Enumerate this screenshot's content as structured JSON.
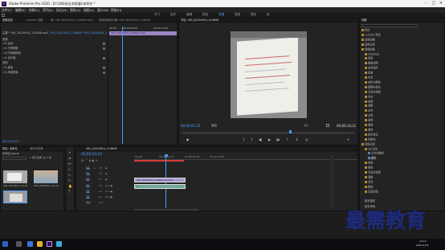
{
  "title_bar": {
    "app_title": "Adobe Premiere Pro 2020 - D:\\\\360安全浏览器\\\\未命名 *",
    "logo": "Pr"
  },
  "menu": [
    "文件(F)",
    "编辑(E)",
    "剪辑(C)",
    "序列(S)",
    "标记(M)",
    "图形(G)",
    "视图(V)",
    "窗口(W)",
    "帮助(H)"
  ],
  "workspaces": [
    "学习",
    "组件",
    "编辑",
    "颜色",
    "效果",
    "音频",
    "图形",
    "库"
  ],
  "active_workspace": "效果",
  "effect_controls": {
    "tabs": [
      "效果控件",
      "Lumetri 范围",
      "源: VID_20210924_114658.mp4",
      "音频剪辑混合器: VID_20210924_114658"
    ],
    "clip_label": "主要 * VID_20210924_114658.mp4",
    "sequence_label": "VID_20210924_114658 * VID_20210924_114658.mp4",
    "section_video": "视频",
    "rows": [
      "运动",
      "不透明度",
      "时间重映射",
      "百叶窗"
    ],
    "section_audio": "音频",
    "audio_rows": [
      "音量",
      "声道音量"
    ],
    "mini_times": [
      "00;00",
      "00;00;05;00",
      "00;00;10;00"
    ],
    "mini_clip": "VID_20210924_114658.mp4",
    "timecode": "00;00;01;02"
  },
  "program_monitor": {
    "title": "节目: VID_20210924_114658",
    "timecode_left": "00;00;01;02",
    "fit": "适合",
    "quality": "1/2",
    "timecode_right": "00;00;14;21"
  },
  "project": {
    "tabs": [
      "项目: 未命名",
      "媒体浏览器"
    ],
    "file_name": "未命名.prproj",
    "items_count": "1 项已选择, 共 2 项",
    "item1_name": "VID_2021092...",
    "item1_dur": "14;21",
    "item2_name": "VID_2021092...",
    "item2_dur": "14;21"
  },
  "timeline": {
    "tab": "VID_20210924_114658",
    "timecode": "00;00;01;02",
    "ruler": [
      "00;00",
      "00;00;04;29",
      "00;00;09;29",
      "00;00;14;29"
    ],
    "video_tracks": [
      "V3",
      "V2",
      "V1"
    ],
    "audio_tracks": [
      "A1",
      "A2",
      "A3"
    ],
    "mix_label": "混合",
    "mix_value": "0.0",
    "video_clip": "VID_20210924_114658.mp4 [V]",
    "audio_clip": "fx"
  },
  "effects": {
    "title": "效果",
    "items": [
      {
        "label": "预设",
        "indent": 0,
        "type": "folder"
      },
      {
        "label": "Lumetri 预设",
        "indent": 0,
        "type": "folder"
      },
      {
        "label": "音频效果",
        "indent": 0,
        "type": "folder"
      },
      {
        "label": "音频过渡",
        "indent": 0,
        "type": "folder"
      },
      {
        "label": "视频效果",
        "indent": 0,
        "type": "folder"
      },
      {
        "label": "Obsolete",
        "indent": 1,
        "type": "folder"
      },
      {
        "label": "变换",
        "indent": 1,
        "type": "folder"
      },
      {
        "label": "图像控制",
        "indent": 1,
        "type": "folder"
      },
      {
        "label": "实用程序",
        "indent": 1,
        "type": "folder"
      },
      {
        "label": "扭曲",
        "indent": 1,
        "type": "folder"
      },
      {
        "label": "时间",
        "indent": 1,
        "type": "folder"
      },
      {
        "label": "杂色与颗粒",
        "indent": 1,
        "type": "folder"
      },
      {
        "label": "模糊与锐化",
        "indent": 1,
        "type": "folder"
      },
      {
        "label": "沉浸式视频",
        "indent": 1,
        "type": "folder"
      },
      {
        "label": "生成",
        "indent": 1,
        "type": "folder"
      },
      {
        "label": "视频",
        "indent": 1,
        "type": "folder"
      },
      {
        "label": "调整",
        "indent": 1,
        "type": "folder"
      },
      {
        "label": "过时",
        "indent": 1,
        "type": "folder"
      },
      {
        "label": "过渡",
        "indent": 1,
        "type": "folder"
      },
      {
        "label": "透视",
        "indent": 1,
        "type": "folder"
      },
      {
        "label": "通道",
        "indent": 1,
        "type": "folder"
      },
      {
        "label": "键控",
        "indent": 1,
        "type": "folder"
      },
      {
        "label": "颜色校正",
        "indent": 1,
        "type": "folder"
      },
      {
        "label": "风格化",
        "indent": 1,
        "type": "folder"
      },
      {
        "label": "视频过渡",
        "indent": 0,
        "type": "folder"
      },
      {
        "label": "3D 运动",
        "indent": 1,
        "type": "folder"
      },
      {
        "label": "立方体旋转",
        "indent": 2,
        "type": "fx"
      },
      {
        "label": "翻转",
        "indent": 2,
        "type": "fx"
      },
      {
        "label": "划像",
        "indent": 1,
        "type": "folder"
      },
      {
        "label": "擦除",
        "indent": 1,
        "type": "folder"
      },
      {
        "label": "沉浸式视频",
        "indent": 1,
        "type": "folder"
      },
      {
        "label": "溶解",
        "indent": 1,
        "type": "folder"
      },
      {
        "label": "滑动",
        "indent": 1,
        "type": "folder"
      },
      {
        "label": "缩放",
        "indent": 1,
        "type": "folder"
      },
      {
        "label": "页面剥落",
        "indent": 1,
        "type": "folder"
      }
    ],
    "sub1": "基本图形",
    "sub2": "基本声音"
  },
  "watermark": "最需教育",
  "taskbar": {
    "time": "10:15",
    "date": "2021/11/9"
  }
}
